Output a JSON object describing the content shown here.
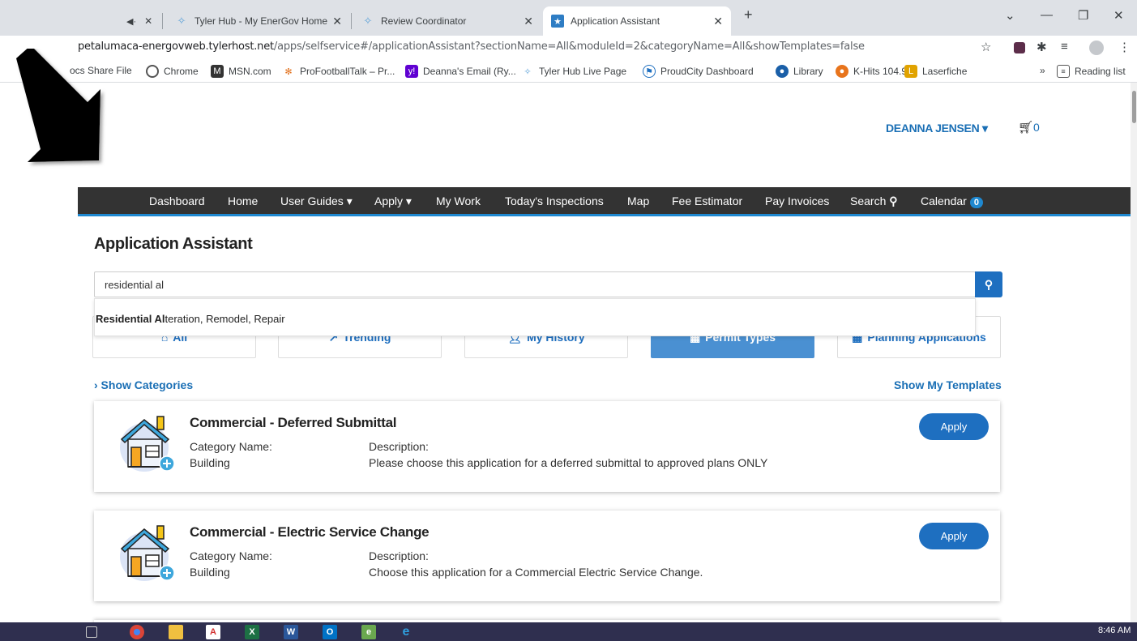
{
  "browser": {
    "tabs": [
      {
        "title": "Tyler Hub - My EnerGov Home",
        "active": false
      },
      {
        "title": "Review Coordinator",
        "active": false
      },
      {
        "title": "Application Assistant",
        "active": true
      }
    ],
    "new_tab_glyph": "+",
    "url_host": "petalumaca-energovweb.tylerhost.net",
    "url_path": "/apps/selfservice#/applicationAssistant?sectionName=All&moduleId=2&categoryName=All&showTemplates=false",
    "bookmarks": [
      "ocs Share File",
      "Chrome",
      "MSN.com",
      "ProFootballTalk – Pr...",
      "Deanna's Email (Ry...",
      "Tyler Hub Live Page",
      "ProudCity Dashboard",
      "Library",
      "K-Hits 104.9",
      "Laserfiche"
    ],
    "bookmarks_more": "»",
    "reading_list": "Reading list"
  },
  "header": {
    "user_name": "DEANNA JENSEN ▾",
    "cart_count": "0"
  },
  "nav": {
    "items": [
      "Dashboard",
      "Home",
      "User Guides ▾",
      "Apply ▾",
      "My Work",
      "Today's Inspections",
      "Map",
      "Fee Estimator",
      "Pay Invoices",
      "Search"
    ],
    "calendar_label": "Calendar",
    "calendar_count": "0"
  },
  "main": {
    "title": "Application Assistant",
    "search_value": "residential al",
    "suggestion_bold": "Residential Al",
    "suggestion_rest": "teration, Remodel, Repair",
    "filter_tabs": [
      "All",
      "Trending",
      "My History",
      "Permit Types",
      "Planning Applications"
    ],
    "active_filter": "Permit Types",
    "show_categories": "› Show Categories",
    "show_templates": "Show My Templates",
    "cards": [
      {
        "title": "Commercial - Deferred Submittal",
        "category_label": "Category Name:",
        "category": "Building",
        "description_label": "Description:",
        "description": "Please choose this application for a deferred submittal to approved plans ONLY",
        "apply": "Apply"
      },
      {
        "title": "Commercial - Electric Service Change",
        "category_label": "Category Name:",
        "category": "Building",
        "description_label": "Description:",
        "description": "Choose this application for a Commercial Electric Service Change.",
        "apply": "Apply"
      }
    ]
  },
  "taskbar": {
    "clock": "8:46 AM"
  },
  "colors": {
    "brand_blue": "#1e6fc0",
    "link_blue": "#1a6fb5",
    "nav_bg": "#333333",
    "active_tab": "#4a90d2"
  }
}
